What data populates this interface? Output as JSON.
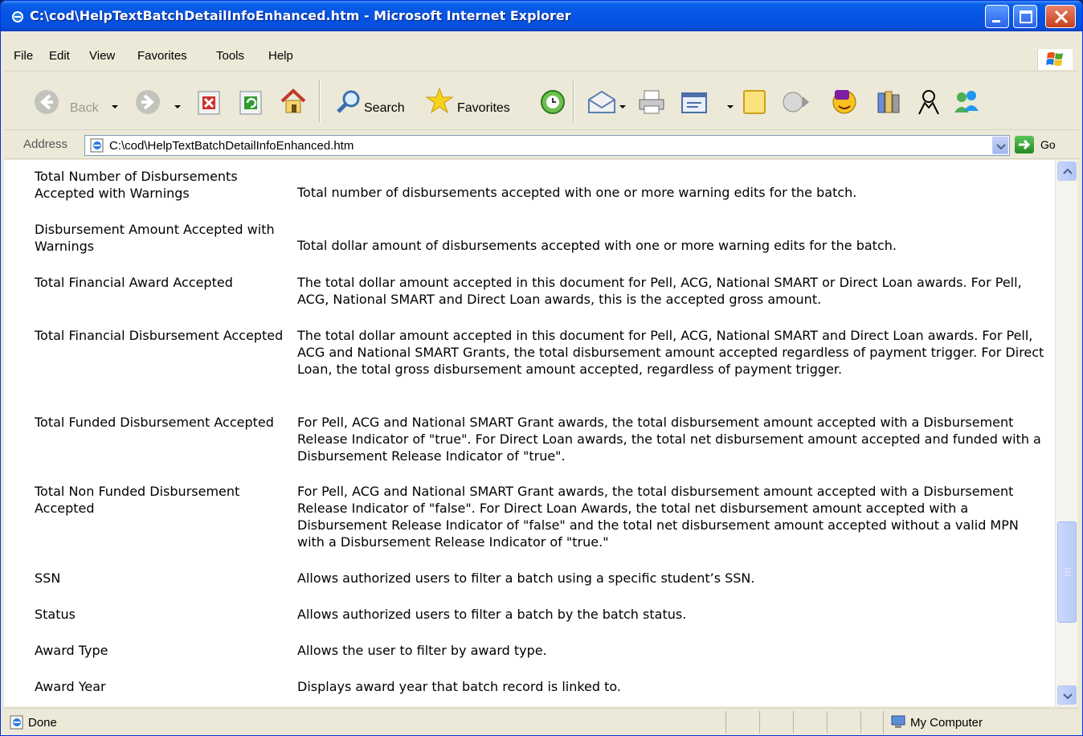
{
  "window": {
    "title": "C:\\cod\\HelpTextBatchDetailInfoEnhanced.htm - Microsoft Internet Explorer"
  },
  "menu": {
    "items": [
      "File",
      "Edit",
      "View",
      "Favorites",
      "Tools",
      "Help"
    ]
  },
  "toolbar": {
    "back_label": "Back",
    "search_label": "Search",
    "favorites_label": "Favorites"
  },
  "address": {
    "label": "Address",
    "url": "C:\\cod\\HelpTextBatchDetailInfoEnhanced.htm",
    "go_label": "Go"
  },
  "content": {
    "rows": [
      {
        "term": "Total Number of Disbursements Accepted with Warnings",
        "desc": "Total number of disbursements accepted with one or more warning edits for the batch."
      },
      {
        "term": "Disbursement Amount Accepted with Warnings",
        "desc": "Total dollar amount of disbursements accepted with one or more warning edits for the batch."
      },
      {
        "term": "Total Financial Award Accepted",
        "desc": "The total dollar amount accepted in this document for Pell, ACG, National SMART or Direct Loan awards. For Pell, ACG, National SMART and Direct Loan awards, this is the accepted gross amount."
      },
      {
        "term": "Total Financial Disbursement Accepted",
        "desc": "The total dollar amount accepted in this document for Pell, ACG, National SMART and Direct Loan awards. For Pell, ACG and National SMART Grants, the total disbursement amount accepted regardless of payment trigger. For Direct Loan, the total gross disbursement amount accepted, regardless of payment trigger."
      },
      {
        "term": "Total Funded Disbursement Accepted",
        "desc": "For Pell, ACG and National SMART Grant awards, the total disbursement amount accepted with a Disbursement Release Indicator of \"true\". For Direct Loan awards, the total net disbursement amount accepted and funded with a Disbursement Release Indicator of \"true\"."
      },
      {
        "term": "Total Non Funded Disbursement Accepted",
        "desc": "For Pell, ACG and National SMART Grant awards, the total disbursement amount accepted with a Disbursement Release Indicator of \"false\". For Direct Loan Awards, the total net disbursement amount accepted with a Disbursement Release Indicator of \"false\" and the total net disbursement amount accepted without a valid MPN with a Disbursement Release Indicator of \"true.\""
      },
      {
        "term": "SSN",
        "desc": "Allows authorized users to filter a batch using a specific student’s SSN."
      },
      {
        "term": "Status",
        "desc": "Allows authorized users to filter a batch by the batch status."
      },
      {
        "term": "Award Type",
        "desc": "Allows the user to filter by award type."
      },
      {
        "term": "Award Year",
        "desc": "Displays award year that batch record is linked to."
      }
    ]
  },
  "status": {
    "text": "Done",
    "zone": "My Computer"
  }
}
